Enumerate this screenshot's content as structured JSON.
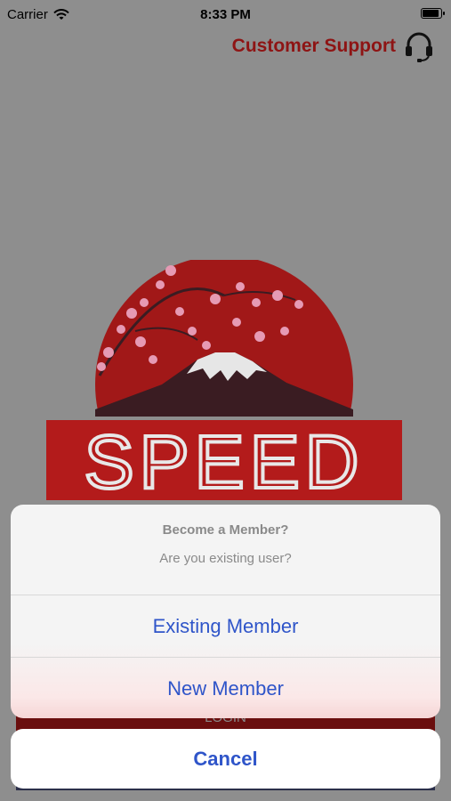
{
  "status_bar": {
    "carrier": "Carrier",
    "time": "8:33 PM"
  },
  "header": {
    "support_label": "Customer Support",
    "support_icon": "headset-icon"
  },
  "logo": {
    "word": "SPEED"
  },
  "background": {
    "login_label": "LOGIN"
  },
  "action_sheet": {
    "title": "Become a Member?",
    "message": "Are you existing user?",
    "buttons": [
      "Existing Member",
      "New Member"
    ],
    "cancel": "Cancel"
  },
  "colors": {
    "accent": "#2f55c9",
    "brand_red": "#8e1414",
    "logo_red": "#b31b1b"
  }
}
